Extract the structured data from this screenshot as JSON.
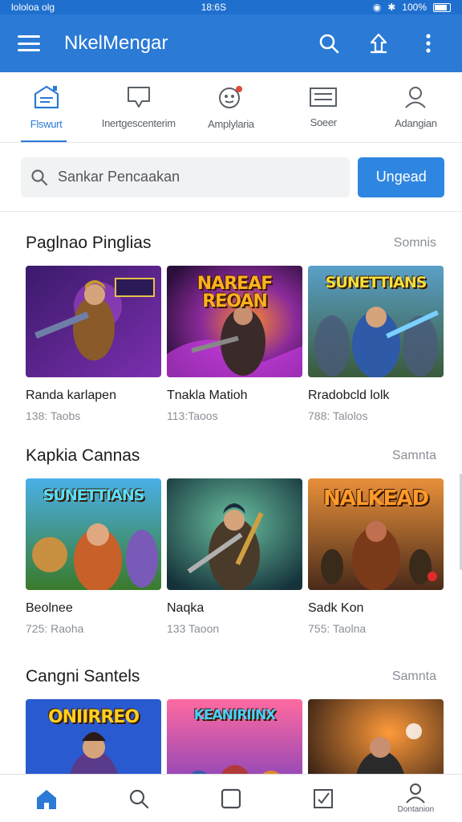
{
  "status_bar": {
    "left": "lololoa olg",
    "center": "18:6S",
    "right": "100%"
  },
  "app_bar": {
    "title": "NkelMengar"
  },
  "tabs": [
    {
      "label": "Flswurt",
      "icon": "home-screen-icon"
    },
    {
      "label": "Inertgescenterim",
      "icon": "message-icon"
    },
    {
      "label": "Amplylaria",
      "icon": "controller-icon"
    },
    {
      "label": "Soeer",
      "icon": "list-icon"
    },
    {
      "label": "Adangian",
      "icon": "user-icon"
    }
  ],
  "search": {
    "placeholder": "Sankar Pencaakan",
    "button_label": "Ungead"
  },
  "sections": [
    {
      "title": "Paglnao Pinglias",
      "see_all": "Somnis",
      "cards": [
        {
          "name": "Randa karlapen",
          "meta": "138: Taobs",
          "banner": "",
          "theme": "purple"
        },
        {
          "name": "Tnakla Matioh",
          "meta": "113:Taoos",
          "banner": "NAREAF REOAN",
          "theme": "violet"
        },
        {
          "name": "Rradobcld lolk",
          "meta": "788: Talolos",
          "banner": "SUNETTIANS",
          "theme": "blue"
        }
      ]
    },
    {
      "title": "Kapkia Cannas",
      "see_all": "Samnta",
      "cards": [
        {
          "name": "Beolnee",
          "meta": "725: Raoha",
          "banner": "SUNETTIANS",
          "theme": "teal"
        },
        {
          "name": "Naqka",
          "meta": "133 Taoon",
          "banner": "",
          "theme": "green"
        },
        {
          "name": "Sadk Kon",
          "meta": "755: Taolna",
          "banner": "NALKEAD",
          "theme": "orange"
        }
      ]
    },
    {
      "title": "Cangni Santels",
      "see_all": "Samnta",
      "cards": [
        {
          "name": "",
          "meta": "",
          "banner": "ONIIRREO",
          "theme": "sky"
        },
        {
          "name": "",
          "meta": "",
          "banner": "KEANIRIINX",
          "theme": "pink"
        },
        {
          "name": "",
          "meta": "",
          "banner": "",
          "theme": "dark"
        }
      ]
    }
  ],
  "bottom_nav": [
    {
      "label": "",
      "icon": "home-icon",
      "active": true
    },
    {
      "label": "",
      "icon": "search-icon"
    },
    {
      "label": "",
      "icon": "square-icon"
    },
    {
      "label": "",
      "icon": "checkbox-icon"
    },
    {
      "label": "Dontanion",
      "icon": "profile-icon"
    }
  ],
  "colors": {
    "accent": "#2a7ad6",
    "button": "#2f86e0"
  }
}
